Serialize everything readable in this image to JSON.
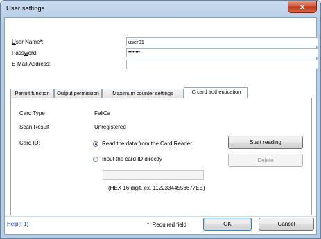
{
  "window": {
    "title": "User settings",
    "close_glyph": "x"
  },
  "form": {
    "user_name_label_prefix": "U",
    "user_name_label_rest": "ser Name*:",
    "user_name_value": "user01",
    "password_label_prefix": "Pass",
    "password_label_u": "w",
    "password_label_rest": "ord:",
    "password_value": "••••••••",
    "email_label_prefix": "E-",
    "email_label_u": "M",
    "email_label_rest": "ail Address:",
    "email_value": ""
  },
  "tabs": [
    {
      "label": "Permit function"
    },
    {
      "label": "Output permission"
    },
    {
      "label": "Maximum counter settings"
    },
    {
      "label": "IC card authentication"
    }
  ],
  "ic_card": {
    "card_type_label": "Card Type",
    "card_type_value": "FeliCa",
    "scan_result_label": "Scan Result",
    "scan_result_value": "Unregistered",
    "card_id_label": "Card ID:",
    "option_reader": "Read the data from the Card Reader",
    "option_direct": "Input the card ID directly",
    "card_id_value": "",
    "hint": "(HEX 16 digit. ex. 11223344556677EE)",
    "start_reading_prefix": "Sta",
    "start_reading_u": "r",
    "start_reading_rest": "t reading",
    "delete_prefix": "De",
    "delete_u": "l",
    "delete_rest": "ete"
  },
  "footer": {
    "help": "Help(F1)",
    "required_note": "*: Required field",
    "ok": "OK",
    "cancel": "Cancel"
  },
  "colors": {
    "title_gradient": "#b6cde7",
    "close_red": "#c4432a",
    "link_blue": "#1a3dbf"
  }
}
